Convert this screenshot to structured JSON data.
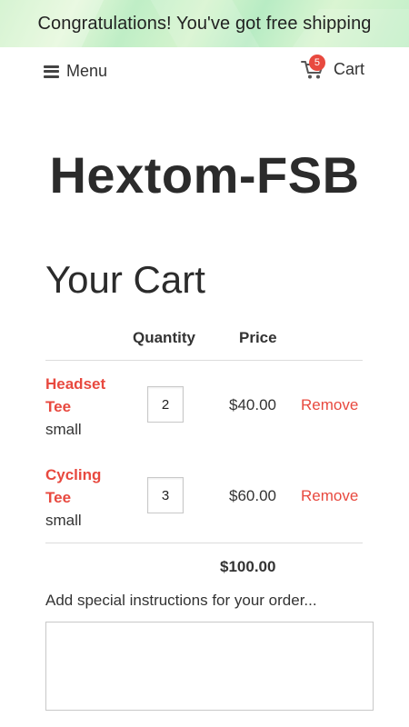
{
  "banner": {
    "text": "Congratulations! You've got free shipping"
  },
  "header": {
    "menu_label": "Menu",
    "menu_icon": "hamburger-icon",
    "cart_label": "Cart",
    "cart_icon": "shopping-cart-icon",
    "cart_count": "5"
  },
  "store": {
    "name": "Hextom-FSB"
  },
  "cart": {
    "title": "Your Cart",
    "columns": {
      "quantity": "Quantity",
      "price": "Price"
    },
    "items": [
      {
        "name_line1": "Headset",
        "name_line2": "Tee",
        "variant": "small",
        "quantity": "2",
        "price": "$40.00",
        "remove_label": "Remove"
      },
      {
        "name_line1": "Cycling",
        "name_line2": "Tee",
        "variant": "small",
        "quantity": "3",
        "price": "$60.00",
        "remove_label": "Remove"
      }
    ],
    "subtotal": "$100.00",
    "instructions_label": "Add special instructions for your order...",
    "instructions_value": ""
  },
  "colors": {
    "accent": "#e8493f",
    "banner_bg": "#c9f0c4",
    "text": "#333333"
  }
}
